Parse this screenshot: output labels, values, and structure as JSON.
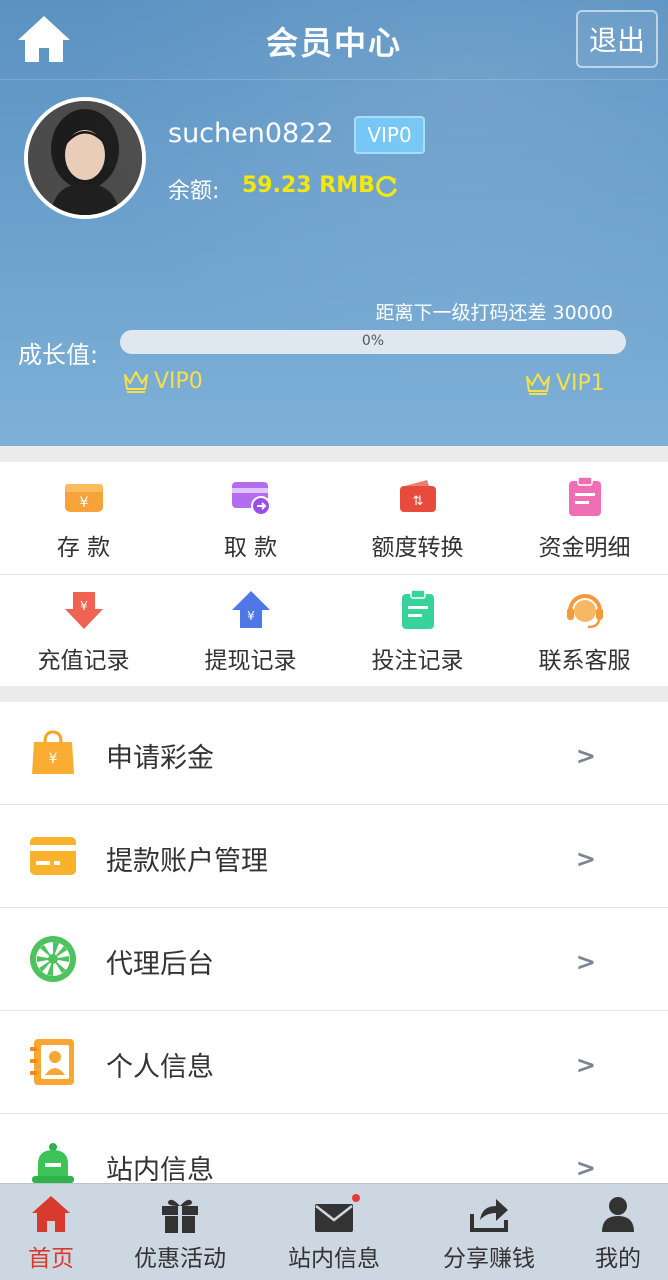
{
  "header": {
    "title": "会员中心",
    "logout_label": "退出"
  },
  "profile": {
    "username": "suchen0822",
    "vip_level": "VIP0",
    "balance_label": "余额:",
    "balance_value": "59.23 RMB"
  },
  "growth": {
    "next_level_text": "距离下一级打码还差 30000",
    "label": "成长值:",
    "progress_text": "0%",
    "progress_fraction": 0,
    "current_level": "VIP0",
    "next_level": "VIP1"
  },
  "grid": {
    "row1": [
      {
        "label": "存 款",
        "icon": "deposit-icon"
      },
      {
        "label": "取 款",
        "icon": "withdraw-card-icon"
      },
      {
        "label": "额度转换",
        "icon": "transfer-wallet-icon"
      },
      {
        "label": "资金明细",
        "icon": "fund-details-icon"
      }
    ],
    "row2": [
      {
        "label": "充值记录",
        "icon": "recharge-record-icon"
      },
      {
        "label": "提现记录",
        "icon": "withdraw-record-icon"
      },
      {
        "label": "投注记录",
        "icon": "bet-record-icon"
      },
      {
        "label": "联系客服",
        "icon": "customer-service-icon"
      }
    ]
  },
  "list": [
    {
      "label": "申请彩金",
      "icon": "bonus-bag-icon"
    },
    {
      "label": "提款账户管理",
      "icon": "bank-card-icon"
    },
    {
      "label": "代理后台",
      "icon": "agent-wheel-icon"
    },
    {
      "label": "个人信息",
      "icon": "contact-book-icon"
    },
    {
      "label": "站内信息",
      "icon": "bell-icon"
    }
  ],
  "arrow_text": ">",
  "bottom_nav": [
    {
      "label": "首页",
      "icon": "home-icon",
      "active": true
    },
    {
      "label": "优惠活动",
      "icon": "gift-icon",
      "active": false
    },
    {
      "label": "站内信息",
      "icon": "mail-icon",
      "active": false
    },
    {
      "label": "分享赚钱",
      "icon": "share-icon",
      "active": false
    },
    {
      "label": "我的",
      "icon": "user-icon",
      "active": false
    }
  ],
  "colors": {
    "accent_yellow": "#f4e600",
    "vip_badge": "#6cc3f5",
    "nav_active": "#d83a2e"
  }
}
